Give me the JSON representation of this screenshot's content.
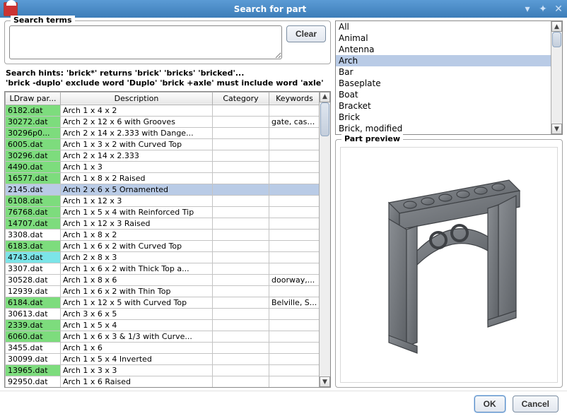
{
  "window": {
    "title": "Search for part",
    "minimize_icon": "▾",
    "maximize_icon": "✦",
    "close_icon": "✕"
  },
  "search": {
    "legend": "Search terms",
    "value": "",
    "clear_btn": "Clear",
    "hints_line1": "Search hints: 'brick*' returns 'brick' 'bricks' 'bricked'...",
    "hints_line2": "'brick -duplo' exclude word 'Duplo' 'brick +axle' must include word 'axle'"
  },
  "table": {
    "headers": {
      "part": "LDraw par...",
      "desc": "Description",
      "cat": "Category",
      "key": "Keywords"
    },
    "rows": [
      {
        "part": "6182.dat",
        "desc": "Arch  1 x  4 x  2",
        "cat": "",
        "key": "",
        "color": "green"
      },
      {
        "part": "30272.dat",
        "desc": "Arch  2 x 12 x  6 with Grooves",
        "cat": "",
        "key": "gate, cast...",
        "color": "green"
      },
      {
        "part": "30296p0...",
        "desc": "Arch  2 x 14 x  2.333 with Dange...",
        "cat": "",
        "key": "",
        "color": "green"
      },
      {
        "part": "6005.dat",
        "desc": "Arch  1 x  3 x  2 with Curved Top",
        "cat": "",
        "key": "",
        "color": "green"
      },
      {
        "part": "30296.dat",
        "desc": "Arch  2 x 14 x  2.333",
        "cat": "",
        "key": "",
        "color": "green"
      },
      {
        "part": "4490.dat",
        "desc": "Arch  1 x  3",
        "cat": "",
        "key": "",
        "color": "green"
      },
      {
        "part": "16577.dat",
        "desc": "Arch  1 x  8 x  2 Raised",
        "cat": "",
        "key": "",
        "color": "green"
      },
      {
        "part": "2145.dat",
        "desc": "Arch  2 x  6 x  5 Ornamented",
        "cat": "",
        "key": "",
        "color": "selected"
      },
      {
        "part": "6108.dat",
        "desc": "Arch  1 x 12 x  3",
        "cat": "",
        "key": "",
        "color": "green"
      },
      {
        "part": "76768.dat",
        "desc": "Arch  1 x  5 x  4 with Reinforced Tip",
        "cat": "",
        "key": "",
        "color": "green"
      },
      {
        "part": "14707.dat",
        "desc": "Arch  1 x 12 x  3 Raised",
        "cat": "",
        "key": "",
        "color": "green"
      },
      {
        "part": "3308.dat",
        "desc": "Arch  1 x  8 x  2",
        "cat": "",
        "key": "",
        "color": ""
      },
      {
        "part": "6183.dat",
        "desc": "Arch  1 x  6 x  2 with Curved Top",
        "cat": "",
        "key": "",
        "color": "green"
      },
      {
        "part": "4743.dat",
        "desc": "Arch  2 x  8 x  3",
        "cat": "",
        "key": "",
        "color": "cyan"
      },
      {
        "part": "3307.dat",
        "desc": "Arch  1 x  6 x  2 with Thick Top a...",
        "cat": "",
        "key": "",
        "color": ""
      },
      {
        "part": "30528.dat",
        "desc": "Arch  1 x  8 x  6",
        "cat": "",
        "key": "doorway,...",
        "color": ""
      },
      {
        "part": "12939.dat",
        "desc": "Arch  1 x  6 x  2 with Thin Top",
        "cat": "",
        "key": "",
        "color": ""
      },
      {
        "part": "6184.dat",
        "desc": "Arch  1 x 12 x  5 with Curved Top",
        "cat": "",
        "key": "Belville, S...",
        "color": "green"
      },
      {
        "part": "30613.dat",
        "desc": "Arch  3 x  6 x  5",
        "cat": "",
        "key": "",
        "color": ""
      },
      {
        "part": "2339.dat",
        "desc": "Arch  1 x  5 x  4",
        "cat": "",
        "key": "",
        "color": "green"
      },
      {
        "part": "6060.dat",
        "desc": "Arch  1 x  6 x  3  & 1/3 with Curve...",
        "cat": "",
        "key": "",
        "color": "green"
      },
      {
        "part": "3455.dat",
        "desc": "Arch  1 x  6",
        "cat": "",
        "key": "",
        "color": ""
      },
      {
        "part": "30099.dat",
        "desc": "Arch  1 x  5 x  4 Inverted",
        "cat": "",
        "key": "",
        "color": ""
      },
      {
        "part": "13965.dat",
        "desc": "Arch  1 x  3 x  3",
        "cat": "",
        "key": "",
        "color": "green"
      },
      {
        "part": "92950.dat",
        "desc": "Arch  1 x  6 Raised",
        "cat": "",
        "key": "",
        "color": ""
      }
    ]
  },
  "categories": [
    "All",
    "Animal",
    "Antenna",
    "Arch",
    "Bar",
    "Baseplate",
    "Boat",
    "Bracket",
    "Brick",
    "Brick, modified"
  ],
  "category_selected_index": 3,
  "preview": {
    "legend": "Part preview"
  },
  "buttons": {
    "ok": "OK",
    "cancel": "Cancel"
  }
}
